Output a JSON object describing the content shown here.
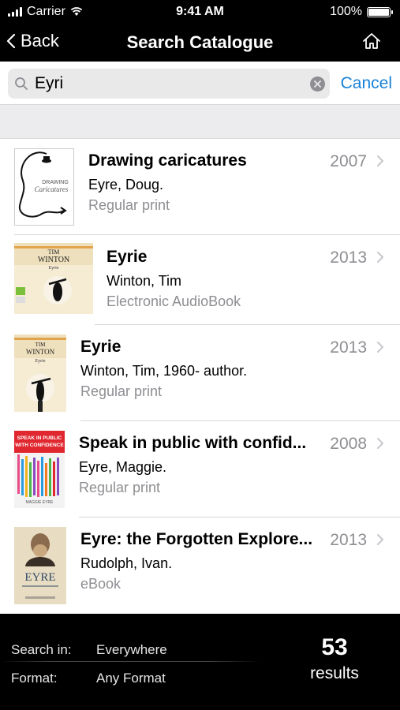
{
  "status_bar": {
    "carrier": "Carrier",
    "time": "9:41 AM",
    "battery": "100%"
  },
  "nav": {
    "back_label": "Back",
    "title": "Search Catalogue"
  },
  "search": {
    "query": "Eyri",
    "cancel_label": "Cancel"
  },
  "results": [
    {
      "title": "Drawing caricatures",
      "author": "Eyre, Doug.",
      "format": "Regular print",
      "year": "2007",
      "cover": {
        "top_text": "DRAWING",
        "script": "Caricatures"
      }
    },
    {
      "title": "Eyrie",
      "author": "Winton, Tim",
      "format": "Electronic AudioBook",
      "year": "2013",
      "cover": {
        "line1": "TIM",
        "line2": "WINTON",
        "line3": "Eyrie"
      }
    },
    {
      "title": "Eyrie",
      "author": "Winton, Tim, 1960- author.",
      "format": "Regular print",
      "year": "2013",
      "cover": {
        "line1": "TIM",
        "line2": "WINTON",
        "line3": "Eyrie"
      }
    },
    {
      "title": "Speak in public with confid...",
      "author": "Eyre, Maggie.",
      "format": "Regular print",
      "year": "2008",
      "cover": {
        "line1": "SPEAK IN PUBLIC",
        "line2": "WITH CONFIDENCE",
        "footer": "MAGGIE EYRE"
      }
    },
    {
      "title": "Eyre: the Forgotten Explore...",
      "author": "Rudolph, Ivan.",
      "format": "eBook",
      "year": "2013",
      "cover": {
        "big": "EYRE"
      }
    }
  ],
  "footer": {
    "search_in_label": "Search in:",
    "search_in_value": "Everywhere",
    "format_label": "Format:",
    "format_value": "Any Format",
    "result_count": "53",
    "results_label": "results"
  },
  "colors": {
    "accent": "#1a82d7",
    "bar": "#000000",
    "secondary_text": "#8e8e93"
  }
}
